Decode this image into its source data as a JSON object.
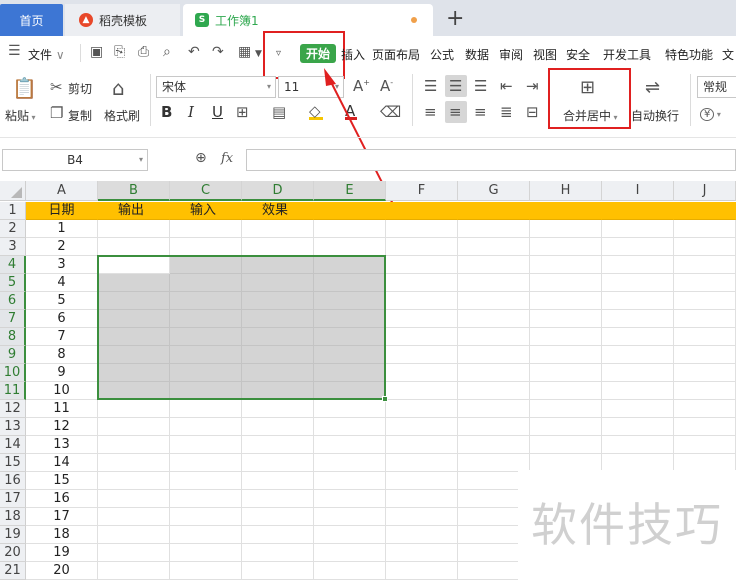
{
  "tabs": {
    "home": "首页",
    "template": "稻壳模板",
    "workbook": "工作簿1",
    "new_tab": "+"
  },
  "menu": {
    "file": "文件",
    "start": "开始",
    "items": [
      "插入",
      "页面布局",
      "公式",
      "数据",
      "审阅",
      "视图",
      "安全",
      "开发工具",
      "特色功能",
      "文"
    ]
  },
  "ribbon": {
    "paste": "粘贴",
    "cut": "剪切",
    "copy": "复制",
    "format_painter": "格式刷",
    "font_name": "宋体",
    "font_size": "11",
    "bold": "B",
    "italic": "I",
    "underline": "U",
    "font_color": "A",
    "merge_center": "合并居中",
    "wrap_text": "自动换行",
    "number_format": "常规",
    "currency": "¥"
  },
  "formula_bar": {
    "cell_ref": "B4",
    "fx": "fx",
    "value": ""
  },
  "sheet": {
    "columns": [
      "A",
      "B",
      "C",
      "D",
      "E",
      "F",
      "G",
      "H",
      "I",
      "J"
    ],
    "header_row": [
      "日期",
      "输出",
      "输入",
      "效果"
    ],
    "dates": [
      "1",
      "2",
      "3",
      "4",
      "5",
      "6",
      "7",
      "8",
      "9",
      "10",
      "11",
      "12",
      "13",
      "14",
      "15",
      "16",
      "17",
      "18",
      "19",
      "20"
    ],
    "row_numbers": [
      "1",
      "2",
      "3",
      "4",
      "5",
      "6",
      "7",
      "8",
      "9",
      "10",
      "11",
      "12",
      "13",
      "14",
      "15",
      "16",
      "17",
      "18",
      "19",
      "20",
      "21"
    ],
    "selection": "B4:E11",
    "header_color": "#ffc000",
    "selection_color": "#3b8f3e"
  },
  "watermark": "软件技巧"
}
